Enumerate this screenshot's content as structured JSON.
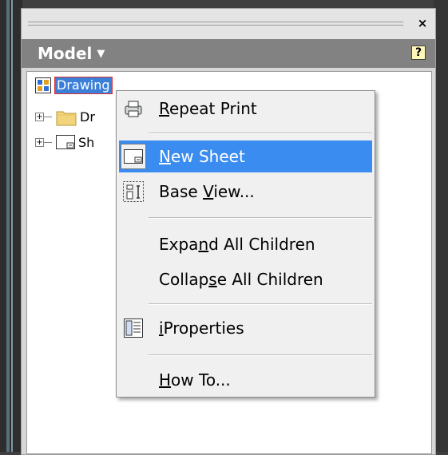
{
  "panel": {
    "close_glyph": "×",
    "model_title": "Model",
    "model_caret": "▼",
    "help_glyph": "?"
  },
  "tree": {
    "root_label": "Drawing",
    "items": [
      {
        "label": "Dr",
        "icon": "folder-icon"
      },
      {
        "label": "Sh",
        "icon": "sheet-icon"
      }
    ],
    "expander_glyph": "+"
  },
  "context_menu": {
    "items": [
      {
        "pre": "",
        "u": "R",
        "post": "epeat Print",
        "icon": "print-icon"
      },
      {
        "pre": "",
        "u": "N",
        "post": "ew Sheet",
        "icon": "new-sheet-icon",
        "highlighted": true
      },
      {
        "pre": "Base ",
        "u": "V",
        "post": "iew...",
        "icon": "base-view-icon"
      },
      {
        "pre": "Expa",
        "u": "n",
        "post": "d All Children"
      },
      {
        "pre": "Collap",
        "u": "s",
        "post": "e All Children"
      },
      {
        "pre": "",
        "u": "i",
        "post": "Properties",
        "icon": "iproperties-icon"
      },
      {
        "pre": "",
        "u": "H",
        "post": "ow To..."
      }
    ]
  },
  "colors": {
    "highlight": "#3b8cf0",
    "model_header": "#828282",
    "selection": "#3c7fd8"
  }
}
